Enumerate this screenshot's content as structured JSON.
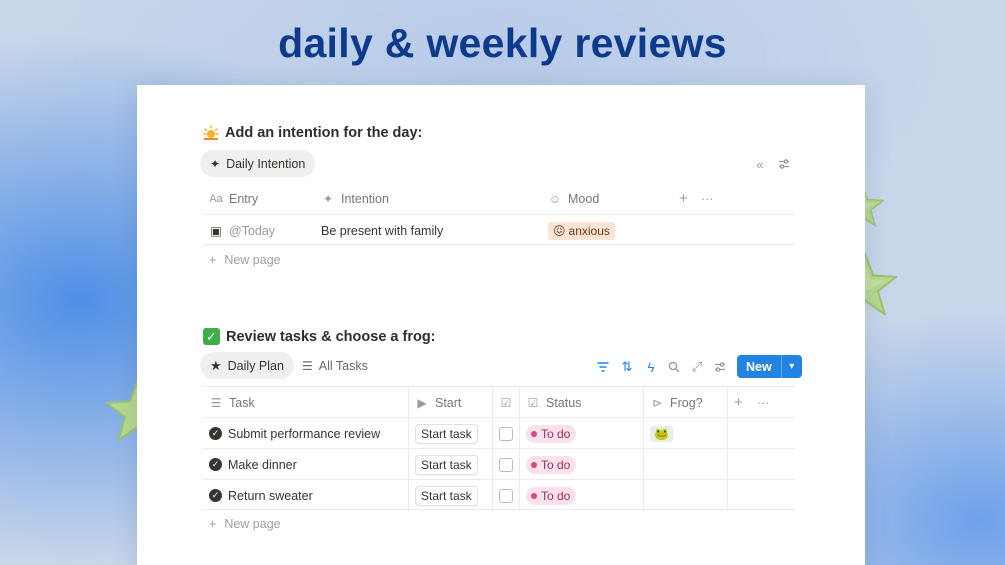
{
  "hero": {
    "title": "daily & weekly reviews"
  },
  "intention_section": {
    "title": "Add an intention for the day:",
    "tab_label": "Daily Intention",
    "columns": [
      {
        "label": "Entry",
        "icon": "text-icon"
      },
      {
        "label": "Intention",
        "icon": "sparkle-icon"
      },
      {
        "label": "Mood",
        "icon": "smiley-icon"
      }
    ],
    "rows": [
      {
        "entry": "@Today",
        "intention": "Be present with family",
        "mood": "anxious",
        "mood_emoji": "😖"
      }
    ],
    "new_page_label": "New page"
  },
  "tasks_section": {
    "title": "Review tasks & choose a frog:",
    "tabs": [
      {
        "label": "Daily Plan",
        "active": true
      },
      {
        "label": "All Tasks",
        "active": false
      }
    ],
    "new_button_label": "New",
    "columns": [
      {
        "label": "Task"
      },
      {
        "label": "Start"
      },
      {
        "label": ""
      },
      {
        "label": "Status"
      },
      {
        "label": "Frog?"
      }
    ],
    "rows": [
      {
        "task": "Submit performance review",
        "start": "Start task",
        "checked": false,
        "status": "To do",
        "frog": "🐸"
      },
      {
        "task": "Make dinner",
        "start": "Start task",
        "checked": false,
        "status": "To do",
        "frog": ""
      },
      {
        "task": "Return sweater",
        "start": "Start task",
        "checked": false,
        "status": "To do",
        "frog": ""
      }
    ],
    "new_page_label": "New page"
  },
  "colors": {
    "accent": "#2383e2",
    "hero_title": "#0e3a8c",
    "status_todo_bg": "#fbe1ec",
    "mood_bg": "#fbe4d4",
    "star": "#b5d88c"
  }
}
